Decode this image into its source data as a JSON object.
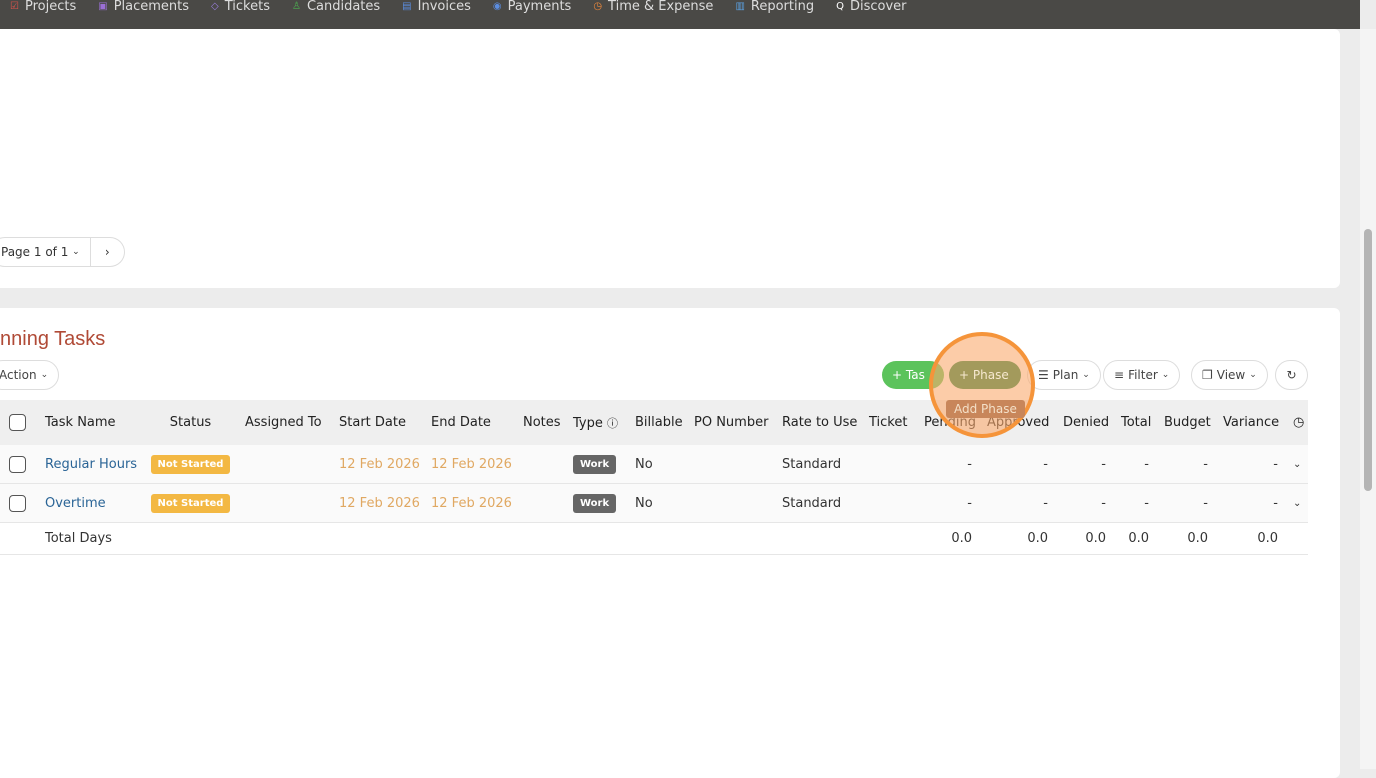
{
  "nav": [
    {
      "label": "Projects",
      "icon": "checkbox-icon",
      "color": "#e0524a"
    },
    {
      "label": "Placements",
      "icon": "briefcase-icon",
      "color": "#9b6fd6"
    },
    {
      "label": "Tickets",
      "icon": "tag-icon",
      "color": "#9b7fe0"
    },
    {
      "label": "Candidates",
      "icon": "users-icon",
      "color": "#4caf50"
    },
    {
      "label": "Invoices",
      "icon": "document-icon",
      "color": "#5b8de0"
    },
    {
      "label": "Payments",
      "icon": "coins-icon",
      "color": "#5b8de0"
    },
    {
      "label": "Time & Expense",
      "icon": "clock-icon",
      "color": "#f08a3c"
    },
    {
      "label": "Reporting",
      "icon": "bar-chart-icon",
      "color": "#5ba0e0"
    },
    {
      "label": "Discover",
      "icon": "search-icon",
      "color": "#ffffff"
    }
  ],
  "pager": {
    "page": "Page 1 of 1",
    "next": "›"
  },
  "section": {
    "title": "nning Tasks",
    "action": "Action",
    "buttons": {
      "task": "+ Tas",
      "phase": "+ Phase",
      "plan": "Plan",
      "filter": "Filter",
      "view": "View"
    },
    "tooltip": "Add Phase"
  },
  "columns": [
    "Task Name",
    "Status",
    "Assigned To",
    "Start Date",
    "End Date",
    "Notes",
    "Type",
    "Billable",
    "PO Number",
    "Rate to Use",
    "Ticket",
    "Pending",
    "Approved",
    "Denied",
    "Total",
    "Budget",
    "Variance"
  ],
  "rows": [
    {
      "name": "Regular Hours",
      "status": "Not Started",
      "start": "12 Feb 2026",
      "end": "12 Feb 2026",
      "type": "Work",
      "billable": "No",
      "rate": "Standard",
      "pending": "-",
      "approved": "-",
      "denied": "-",
      "total": "-",
      "budget": "-",
      "variance": "-"
    },
    {
      "name": "Overtime",
      "status": "Not Started",
      "start": "12 Feb 2026",
      "end": "12 Feb 2026",
      "type": "Work",
      "billable": "No",
      "rate": "Standard",
      "pending": "-",
      "approved": "-",
      "denied": "-",
      "total": "-",
      "budget": "-",
      "variance": "-"
    }
  ],
  "totals": {
    "label": "Total Days",
    "pending": "0.0",
    "approved": "0.0",
    "denied": "0.0",
    "total": "0.0",
    "budget": "0.0",
    "variance": "0.0"
  }
}
